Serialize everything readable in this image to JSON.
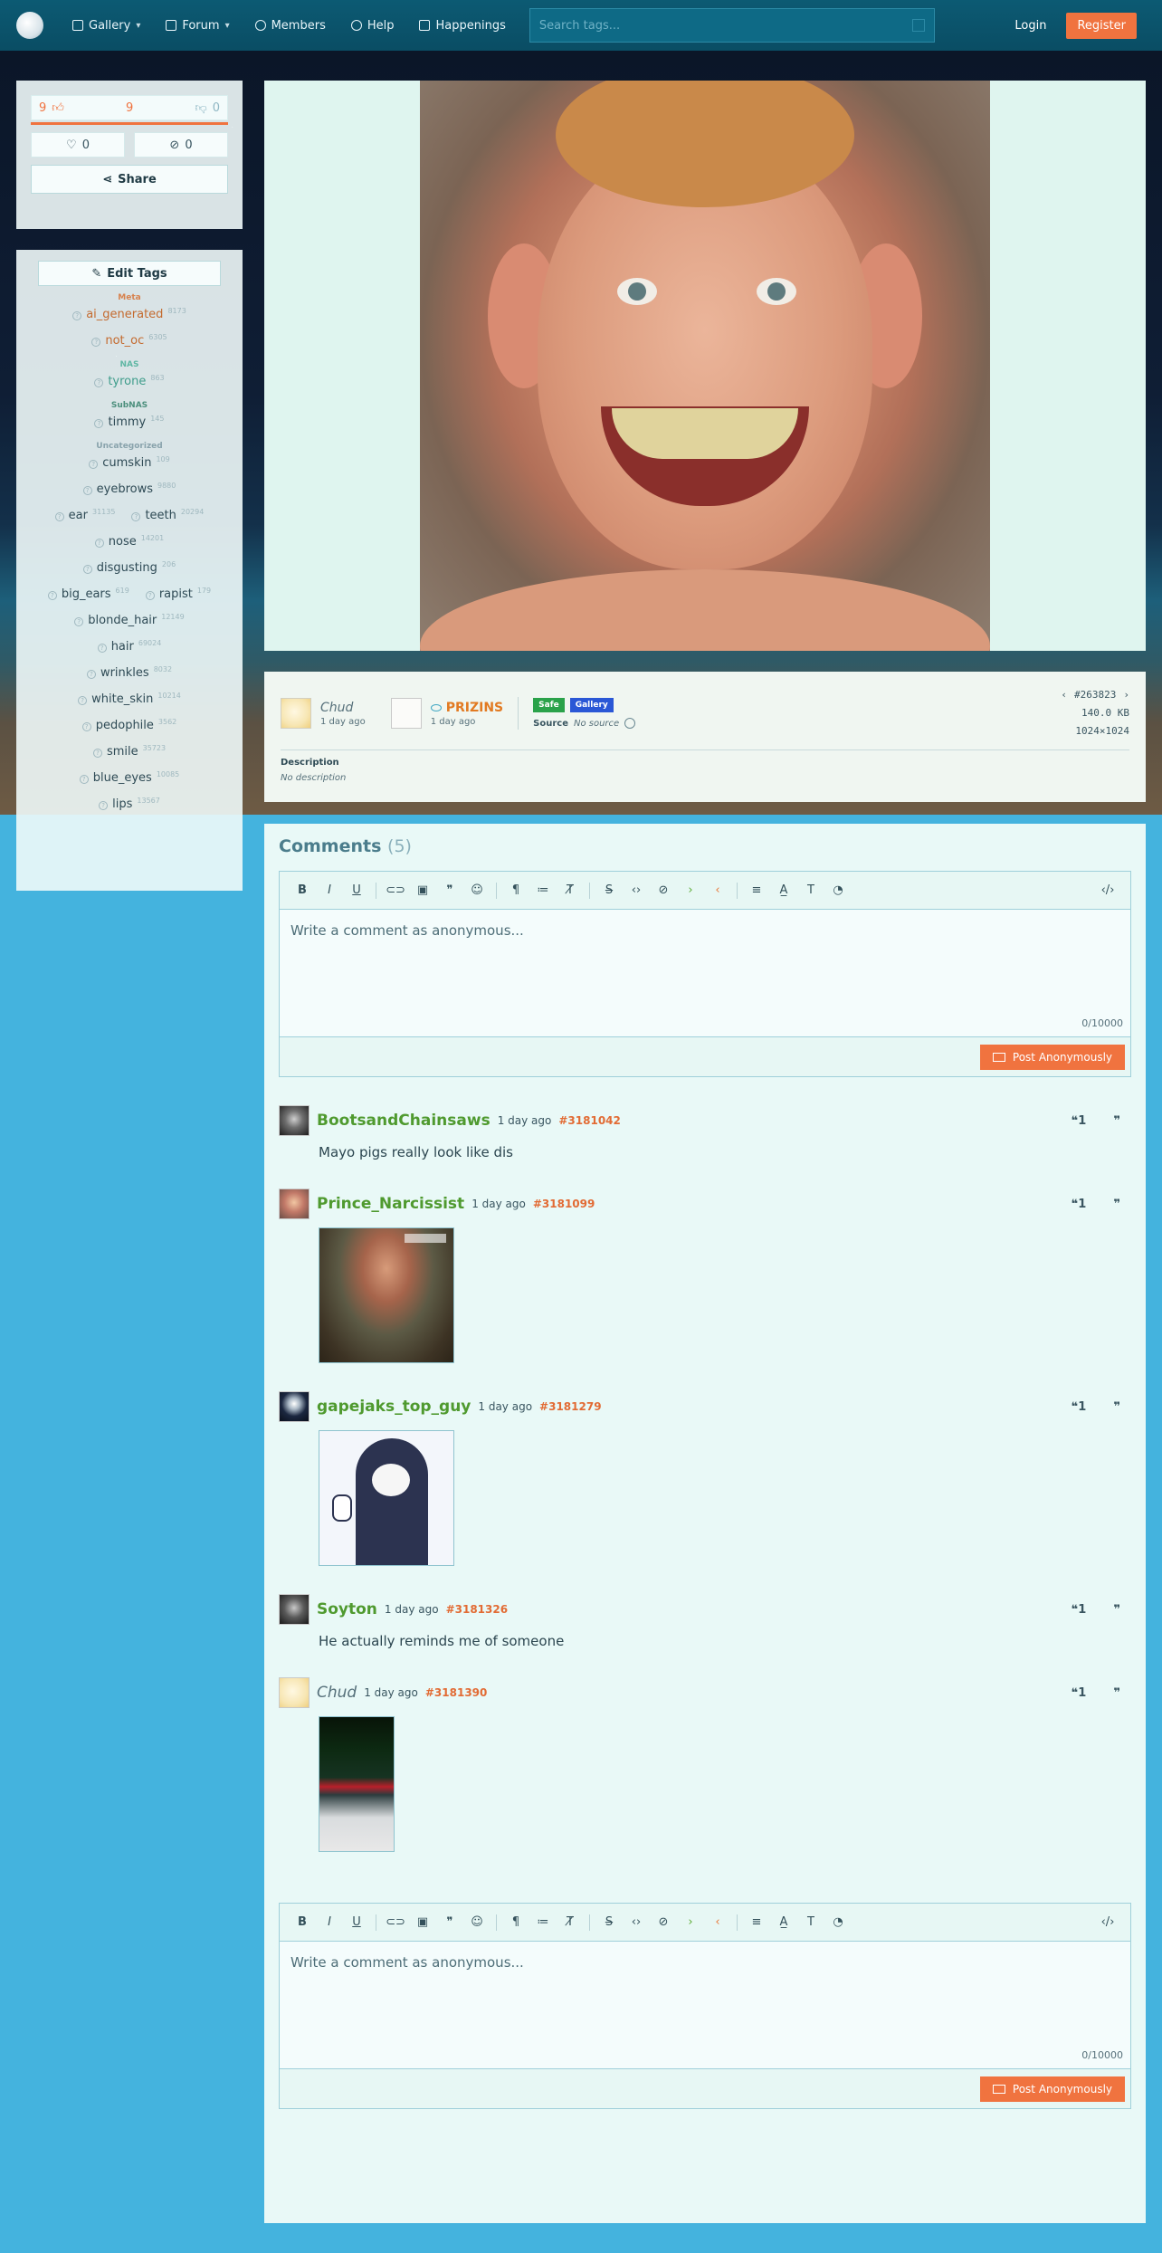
{
  "nav": {
    "items": [
      {
        "label": "Gallery",
        "icon": "image-icon",
        "dropdown": true
      },
      {
        "label": "Forum",
        "icon": "chat-icon",
        "dropdown": true
      },
      {
        "label": "Members",
        "icon": "user-icon",
        "dropdown": false
      },
      {
        "label": "Help",
        "icon": "help-icon",
        "dropdown": false
      },
      {
        "label": "Happenings",
        "icon": "book-icon",
        "dropdown": false
      }
    ],
    "search_placeholder": "Search tags...",
    "login": "Login",
    "register": "Register"
  },
  "votes": {
    "up": "9",
    "score": "9",
    "down": "0",
    "favorites": "0",
    "hidden": "0",
    "share": "Share"
  },
  "tags": {
    "edit_label": "Edit Tags",
    "categories": {
      "meta": "Meta",
      "nas": "NAS",
      "subnas": "SubNAS",
      "uncategorized": "Uncategorized"
    },
    "meta": [
      {
        "name": "ai_generated",
        "count": "8173"
      },
      {
        "name": "not_oc",
        "count": "6305"
      }
    ],
    "nas": [
      {
        "name": "tyrone",
        "count": "863"
      }
    ],
    "subnas": [
      {
        "name": "timmy",
        "count": "145"
      }
    ],
    "uncategorized": [
      {
        "name": "cumskin",
        "count": "109"
      },
      {
        "name": "eyebrows",
        "count": "9880"
      },
      {
        "name": "ear",
        "count": "31135"
      },
      {
        "name": "teeth",
        "count": "20294"
      },
      {
        "name": "nose",
        "count": "14201"
      },
      {
        "name": "disgusting",
        "count": "206"
      },
      {
        "name": "big_ears",
        "count": "619"
      },
      {
        "name": "rapist",
        "count": "179"
      },
      {
        "name": "blonde_hair",
        "count": "12149"
      },
      {
        "name": "hair",
        "count": "69024"
      },
      {
        "name": "wrinkles",
        "count": "8032"
      },
      {
        "name": "white_skin",
        "count": "10214"
      },
      {
        "name": "pedophile",
        "count": "3562"
      },
      {
        "name": "smile",
        "count": "35723"
      },
      {
        "name": "blue_eyes",
        "count": "10085"
      },
      {
        "name": "lips",
        "count": "13567"
      }
    ]
  },
  "post": {
    "poster": "Chud",
    "poster_time": "1 day ago",
    "uploader": "PRIZINS",
    "uploader_time": "1 day ago",
    "rating": "Safe",
    "category": "Gallery",
    "source_label": "Source",
    "source_value": "No source",
    "id": "#263823",
    "size": "140.0 KB",
    "dimensions": "1024×1024",
    "description_label": "Description",
    "description_value": "No description"
  },
  "comments": {
    "title": "Comments",
    "count": "(5)",
    "placeholder": "Write a comment as anonymous...",
    "counter": "0/10000",
    "post_label": "Post Anonymously",
    "items": [
      {
        "user": "BootsandChainsaws",
        "time": "1 day ago",
        "id": "#3181042",
        "text": "Mayo pigs really look like dis"
      },
      {
        "user": "Prince_Narcissist",
        "time": "1 day ago",
        "id": "#3181099",
        "text": ""
      },
      {
        "user": "gapejaks_top_guy",
        "time": "1 day ago",
        "id": "#3181279",
        "text": ""
      },
      {
        "user": "Soyton",
        "time": "1 day ago",
        "id": "#3181326",
        "text": "He actually reminds me of someone"
      },
      {
        "user": "Chud",
        "time": "1 day ago",
        "id": "#3181390",
        "text": ""
      }
    ]
  }
}
